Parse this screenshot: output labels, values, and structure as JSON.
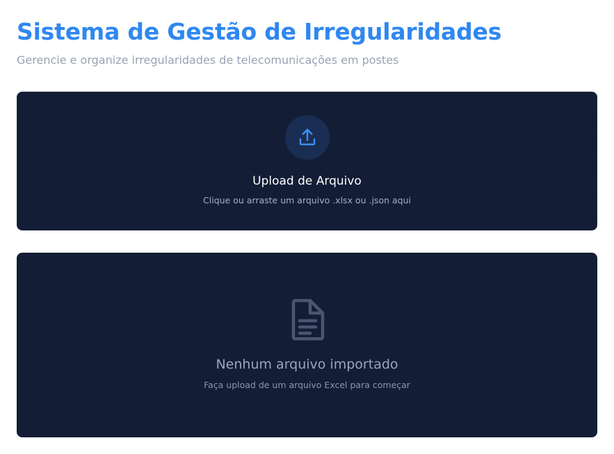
{
  "header": {
    "title": "Sistema de Gestão de Irregularidades",
    "subtitle": "Gerencie e organize irregularidades de telecomunicações em postes"
  },
  "upload": {
    "title": "Upload de Arquivo",
    "hint": "Clique ou arraste um arquivo .xlsx ou .json aqui",
    "icon": "upload-icon"
  },
  "empty_state": {
    "title": "Nenhum arquivo importado",
    "hint": "Faça upload de um arquivo Excel para começar",
    "icon": "file-text-icon"
  },
  "colors": {
    "accent": "#2f88f0",
    "card_bg": "#131d35",
    "icon_muted": "#4a5671"
  }
}
